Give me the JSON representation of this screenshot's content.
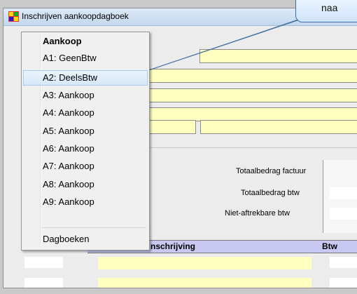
{
  "window": {
    "title": "Inschrijven aankoopdagboek"
  },
  "callout": {
    "text": "naa"
  },
  "menu": {
    "header": "Aankoop",
    "items": [
      {
        "label": "A1: GeenBtw",
        "selected": false
      },
      {
        "label": "A2: DeelsBtw",
        "selected": true
      },
      {
        "label": "A3: Aankoop",
        "selected": false
      },
      {
        "label": "A4: Aankoop",
        "selected": false
      },
      {
        "label": "A5: Aankoop",
        "selected": false
      },
      {
        "label": "A6: Aankoop",
        "selected": false
      },
      {
        "label": "A7: Aankoop",
        "selected": false
      },
      {
        "label": "A8: Aankoop",
        "selected": false
      },
      {
        "label": "A9: Aankoop",
        "selected": false
      }
    ],
    "footer": "Dagboeken"
  },
  "form": {
    "totaal_factuur_label": "Totaalbedrag factuur",
    "totaal_btw_label": "Totaalbedrag btw",
    "niet_aftrekbaar_label": "Niet-aftrekbare btw"
  },
  "table": {
    "col_inschrijving": "nschrijving",
    "col_btw": "Btw"
  },
  "colors": {
    "field_yellow": "#ffffc0",
    "header_lavender": "#c8c8f2",
    "selection_blue": "#d7e8f9"
  }
}
